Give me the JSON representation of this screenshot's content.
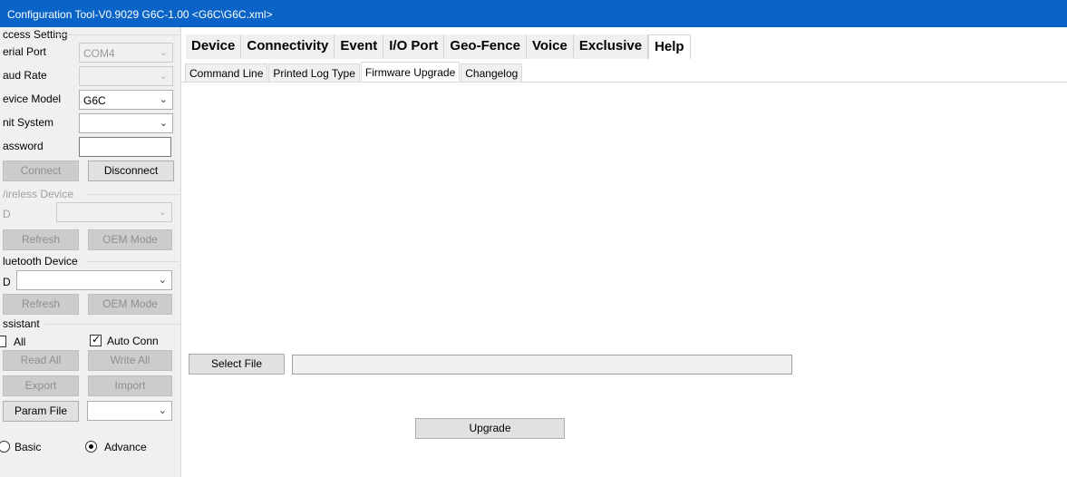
{
  "window": {
    "title": "Configuration Tool-V0.9029 G6C-1.00 <G6C\\G6C.xml>"
  },
  "access_setting": {
    "group_label": "ccess Setting",
    "serial_port": {
      "label": "erial Port",
      "value": "COM4"
    },
    "baud_rate": {
      "label": "aud Rate",
      "value": ""
    },
    "device_model": {
      "label": "evice Model",
      "value": "G6C"
    },
    "unit_system": {
      "label": "nit System",
      "value": ""
    },
    "password": {
      "label": "assword",
      "value": ""
    },
    "connect_label": "Connect",
    "disconnect_label": "Disconnect"
  },
  "wireless_device": {
    "group_label": "/ireless Device",
    "id_label": "D",
    "refresh_label": "Refresh",
    "oem_label": "OEM Mode"
  },
  "bluetooth_device": {
    "group_label": "luetooth Device",
    "id_label": "D",
    "refresh_label": "Refresh",
    "oem_label": "OEM Mode"
  },
  "assistant": {
    "group_label": "ssistant",
    "all_label": "All",
    "auto_conn_label": "Auto Conn",
    "read_all_label": "Read All",
    "write_all_label": "Write All",
    "export_label": "Export",
    "import_label": "Import",
    "param_file_label": "Param File",
    "basic_label": "Basic",
    "advance_label": "Advance"
  },
  "main_tabs": [
    "Device",
    "Connectivity",
    "Event",
    "I/O Port",
    "Geo-Fence",
    "Voice",
    "Exclusive",
    "Help"
  ],
  "sub_tabs": [
    "Command Line",
    "Printed Log Type",
    "Firmware Upgrade",
    "Changelog"
  ],
  "firmware": {
    "select_file_label": "Select File",
    "file_path": "",
    "upgrade_label": "Upgrade"
  }
}
